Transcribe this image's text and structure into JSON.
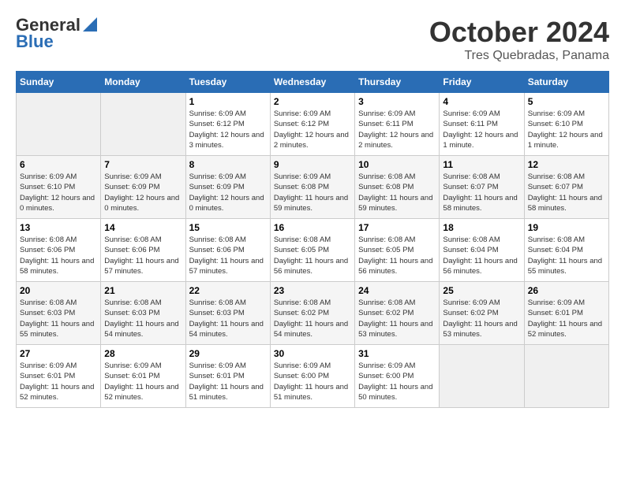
{
  "header": {
    "logo_line1": "General",
    "logo_line2": "Blue",
    "month": "October 2024",
    "location": "Tres Quebradas, Panama"
  },
  "days_of_week": [
    "Sunday",
    "Monday",
    "Tuesday",
    "Wednesday",
    "Thursday",
    "Friday",
    "Saturday"
  ],
  "weeks": [
    [
      {
        "num": "",
        "info": ""
      },
      {
        "num": "",
        "info": ""
      },
      {
        "num": "1",
        "info": "Sunrise: 6:09 AM\nSunset: 6:12 PM\nDaylight: 12 hours and 3 minutes."
      },
      {
        "num": "2",
        "info": "Sunrise: 6:09 AM\nSunset: 6:12 PM\nDaylight: 12 hours and 2 minutes."
      },
      {
        "num": "3",
        "info": "Sunrise: 6:09 AM\nSunset: 6:11 PM\nDaylight: 12 hours and 2 minutes."
      },
      {
        "num": "4",
        "info": "Sunrise: 6:09 AM\nSunset: 6:11 PM\nDaylight: 12 hours and 1 minute."
      },
      {
        "num": "5",
        "info": "Sunrise: 6:09 AM\nSunset: 6:10 PM\nDaylight: 12 hours and 1 minute."
      }
    ],
    [
      {
        "num": "6",
        "info": "Sunrise: 6:09 AM\nSunset: 6:10 PM\nDaylight: 12 hours and 0 minutes."
      },
      {
        "num": "7",
        "info": "Sunrise: 6:09 AM\nSunset: 6:09 PM\nDaylight: 12 hours and 0 minutes."
      },
      {
        "num": "8",
        "info": "Sunrise: 6:09 AM\nSunset: 6:09 PM\nDaylight: 12 hours and 0 minutes."
      },
      {
        "num": "9",
        "info": "Sunrise: 6:09 AM\nSunset: 6:08 PM\nDaylight: 11 hours and 59 minutes."
      },
      {
        "num": "10",
        "info": "Sunrise: 6:08 AM\nSunset: 6:08 PM\nDaylight: 11 hours and 59 minutes."
      },
      {
        "num": "11",
        "info": "Sunrise: 6:08 AM\nSunset: 6:07 PM\nDaylight: 11 hours and 58 minutes."
      },
      {
        "num": "12",
        "info": "Sunrise: 6:08 AM\nSunset: 6:07 PM\nDaylight: 11 hours and 58 minutes."
      }
    ],
    [
      {
        "num": "13",
        "info": "Sunrise: 6:08 AM\nSunset: 6:06 PM\nDaylight: 11 hours and 58 minutes."
      },
      {
        "num": "14",
        "info": "Sunrise: 6:08 AM\nSunset: 6:06 PM\nDaylight: 11 hours and 57 minutes."
      },
      {
        "num": "15",
        "info": "Sunrise: 6:08 AM\nSunset: 6:06 PM\nDaylight: 11 hours and 57 minutes."
      },
      {
        "num": "16",
        "info": "Sunrise: 6:08 AM\nSunset: 6:05 PM\nDaylight: 11 hours and 56 minutes."
      },
      {
        "num": "17",
        "info": "Sunrise: 6:08 AM\nSunset: 6:05 PM\nDaylight: 11 hours and 56 minutes."
      },
      {
        "num": "18",
        "info": "Sunrise: 6:08 AM\nSunset: 6:04 PM\nDaylight: 11 hours and 56 minutes."
      },
      {
        "num": "19",
        "info": "Sunrise: 6:08 AM\nSunset: 6:04 PM\nDaylight: 11 hours and 55 minutes."
      }
    ],
    [
      {
        "num": "20",
        "info": "Sunrise: 6:08 AM\nSunset: 6:03 PM\nDaylight: 11 hours and 55 minutes."
      },
      {
        "num": "21",
        "info": "Sunrise: 6:08 AM\nSunset: 6:03 PM\nDaylight: 11 hours and 54 minutes."
      },
      {
        "num": "22",
        "info": "Sunrise: 6:08 AM\nSunset: 6:03 PM\nDaylight: 11 hours and 54 minutes."
      },
      {
        "num": "23",
        "info": "Sunrise: 6:08 AM\nSunset: 6:02 PM\nDaylight: 11 hours and 54 minutes."
      },
      {
        "num": "24",
        "info": "Sunrise: 6:08 AM\nSunset: 6:02 PM\nDaylight: 11 hours and 53 minutes."
      },
      {
        "num": "25",
        "info": "Sunrise: 6:09 AM\nSunset: 6:02 PM\nDaylight: 11 hours and 53 minutes."
      },
      {
        "num": "26",
        "info": "Sunrise: 6:09 AM\nSunset: 6:01 PM\nDaylight: 11 hours and 52 minutes."
      }
    ],
    [
      {
        "num": "27",
        "info": "Sunrise: 6:09 AM\nSunset: 6:01 PM\nDaylight: 11 hours and 52 minutes."
      },
      {
        "num": "28",
        "info": "Sunrise: 6:09 AM\nSunset: 6:01 PM\nDaylight: 11 hours and 52 minutes."
      },
      {
        "num": "29",
        "info": "Sunrise: 6:09 AM\nSunset: 6:01 PM\nDaylight: 11 hours and 51 minutes."
      },
      {
        "num": "30",
        "info": "Sunrise: 6:09 AM\nSunset: 6:00 PM\nDaylight: 11 hours and 51 minutes."
      },
      {
        "num": "31",
        "info": "Sunrise: 6:09 AM\nSunset: 6:00 PM\nDaylight: 11 hours and 50 minutes."
      },
      {
        "num": "",
        "info": ""
      },
      {
        "num": "",
        "info": ""
      }
    ]
  ]
}
